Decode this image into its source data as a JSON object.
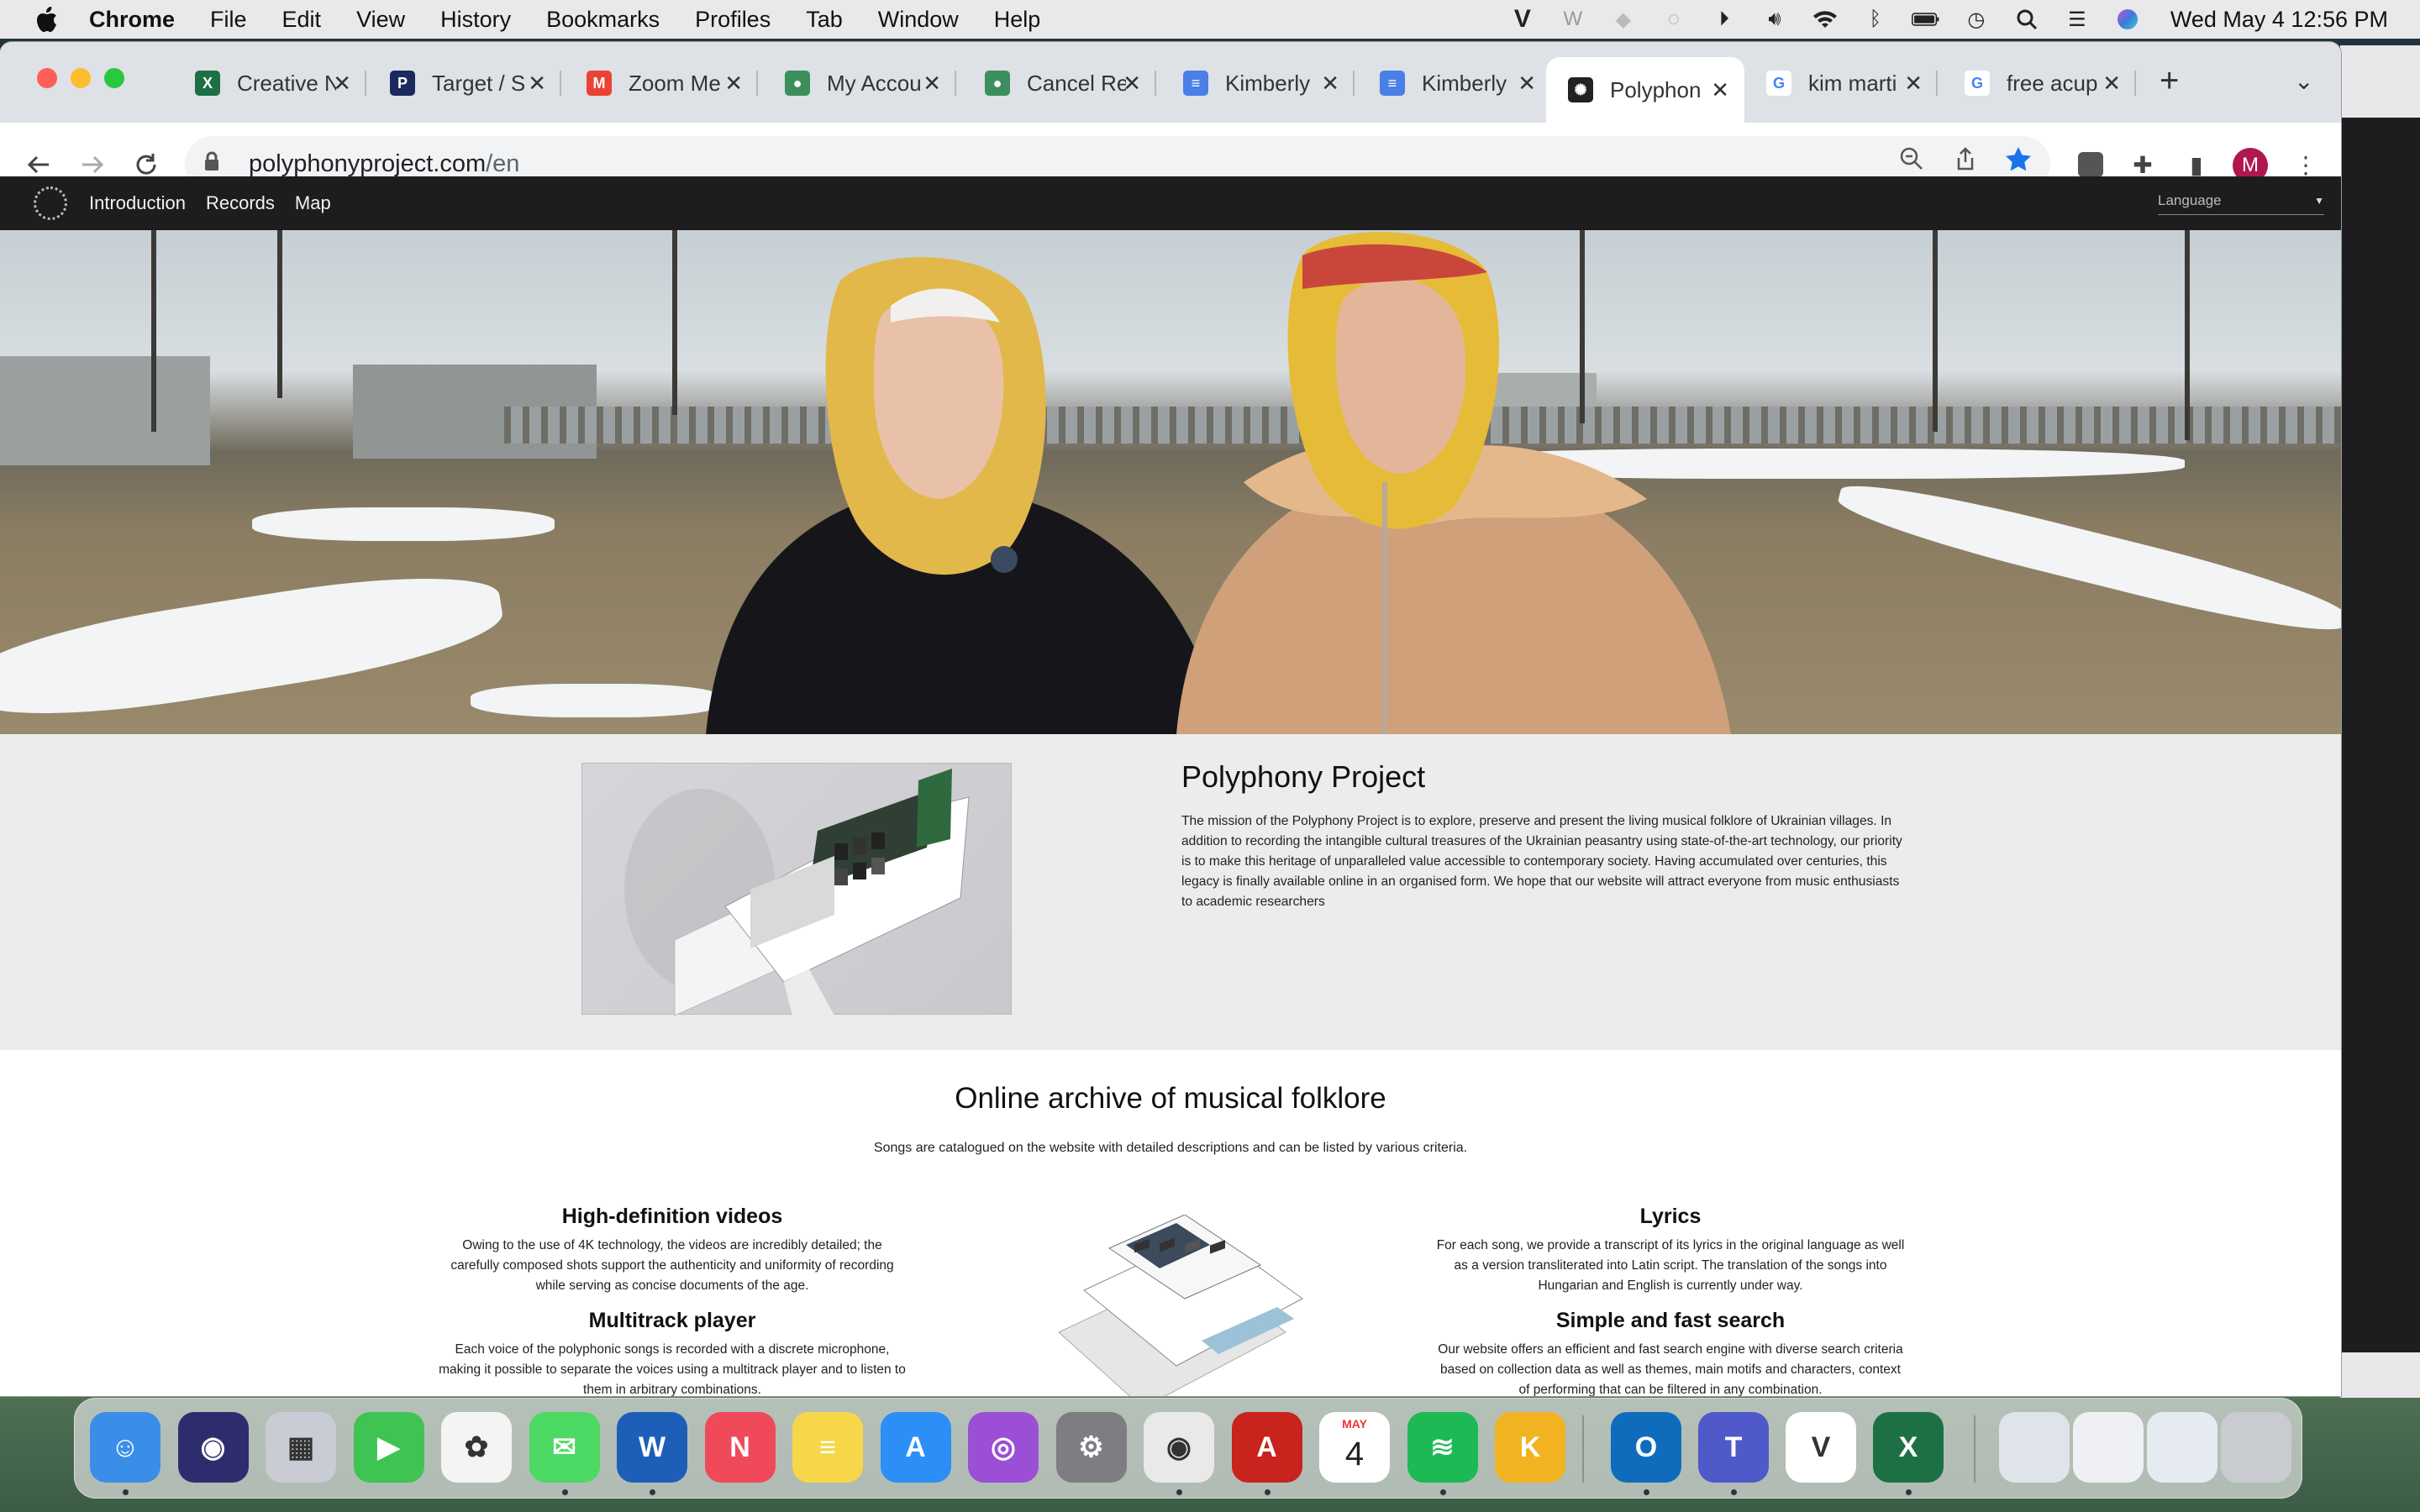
{
  "menubar": {
    "app": "Chrome",
    "items": [
      "File",
      "Edit",
      "View",
      "History",
      "Bookmarks",
      "Profiles",
      "Tab",
      "Window",
      "Help"
    ],
    "clock": "Wed May 4  12:56 PM"
  },
  "tabs": [
    {
      "label": "Creative N",
      "icon": "excel-icon",
      "color": "#1d7044",
      "glyph": "X"
    },
    {
      "label": "Target / S",
      "icon": "paypal-icon",
      "color": "#1b2a5e",
      "glyph": "P"
    },
    {
      "label": "Zoom Me",
      "icon": "gmail-icon",
      "color": "#ea4335",
      "glyph": "M"
    },
    {
      "label": "My Accou",
      "icon": "account-icon",
      "color": "#3b8f5c",
      "glyph": "●"
    },
    {
      "label": "Cancel Re",
      "icon": "account-icon",
      "color": "#3b8f5c",
      "glyph": "●"
    },
    {
      "label": "Kimberly",
      "icon": "docs-icon",
      "color": "#4a7fe8",
      "glyph": "≡"
    },
    {
      "label": "Kimberly",
      "icon": "docs-icon",
      "color": "#4a7fe8",
      "glyph": "≡"
    },
    {
      "label": "Polyphon",
      "icon": "polyphony-icon",
      "color": "#222222",
      "glyph": "✺",
      "active": true
    },
    {
      "label": "kim marti",
      "icon": "google-icon",
      "color": "#ffffff",
      "glyph": "G"
    },
    {
      "label": "free acup",
      "icon": "google-icon",
      "color": "#ffffff",
      "glyph": "G"
    }
  ],
  "address": {
    "domain": "polyphonyproject.com",
    "path": "/en"
  },
  "site": {
    "nav": [
      "Introduction",
      "Records",
      "Map"
    ],
    "language_placeholder": "Language",
    "about_title": "Polyphony Project",
    "about_text": "The mission of the Polyphony Project is to explore, preserve and present the living musical folklore of Ukrainian villages. In addition to recording the intangible cultural treasures of the Ukrainian peasantry using state-of-the-art technology, our priority is to make this heritage of unparalleled value accessible to contemporary society. Having accumulated over centuries, this legacy is finally available online in an organised form. We hope that our website will attract everyone from music enthusiasts to academic researchers",
    "archive_title": "Online archive of musical folklore",
    "archive_sub": "Songs are catalogued on the website with detailed descriptions and can be listed by various criteria.",
    "features": {
      "hd_title": "High-definition videos",
      "hd_text": "Owing to the use of 4K technology, the videos are incredibly detailed; the carefully composed shots support the authenticity and uniformity of recording while serving as concise documents of the age.",
      "mt_title": "Multitrack player",
      "mt_text": "Each voice of the polyphonic songs is recorded with a discrete microphone, making it possible to separate the voices using a multitrack player and to listen to them in arbitrary combinations.",
      "ly_title": "Lyrics",
      "ly_text": "For each song, we provide a transcript of its lyrics in the original language as well as a version transliterated into Latin script. The translation of the songs into Hungarian and English is currently under way.",
      "sf_title": "Simple and fast search",
      "sf_text": "Our website offers an efficient and fast search engine with diverse search criteria based on collection data as well as themes, main motifs and characters, context of performing that can be filtered in any combination."
    }
  },
  "avatar_letter": "M",
  "dock": [
    {
      "name": "finder-icon",
      "color": "#3a8ee8",
      "glyph": "☺"
    },
    {
      "name": "siri-icon",
      "color": "#2d2d6e",
      "glyph": "◉"
    },
    {
      "name": "launchpad-icon",
      "color": "#c9ccd4",
      "glyph": "▦"
    },
    {
      "name": "facetime-icon",
      "color": "#3fc454",
      "glyph": "▶"
    },
    {
      "name": "photos-icon",
      "color": "#f4f4f4",
      "glyph": "✿"
    },
    {
      "name": "messages-icon",
      "color": "#4cd964",
      "glyph": "✉"
    },
    {
      "name": "word-icon",
      "color": "#1d5fb8",
      "glyph": "W"
    },
    {
      "name": "news-icon",
      "color": "#f04a5a",
      "glyph": "N"
    },
    {
      "name": "notes-icon",
      "color": "#f7d74a",
      "glyph": "≡"
    },
    {
      "name": "app-store-icon",
      "color": "#2b8ff6",
      "glyph": "A"
    },
    {
      "name": "podcasts-icon",
      "color": "#9b4fd6",
      "glyph": "◎"
    },
    {
      "name": "system-preferences-icon",
      "color": "#7d7d82",
      "glyph": "⚙"
    },
    {
      "name": "chrome-icon",
      "color": "#e9e9e9",
      "glyph": "◉"
    },
    {
      "name": "acrobat-icon",
      "color": "#c8231c",
      "glyph": "A"
    },
    {
      "name": "calendar-icon",
      "color": "#ffffff",
      "glyph": "4",
      "month": "MAY"
    },
    {
      "name": "spotify-icon",
      "color": "#1db954",
      "glyph": "≋"
    },
    {
      "name": "keynote-icon",
      "color": "#f2b323",
      "glyph": "K"
    },
    {
      "name": "outlook-icon",
      "color": "#0f6cbd",
      "glyph": "O"
    },
    {
      "name": "teams-icon",
      "color": "#5059c9",
      "glyph": "T"
    },
    {
      "name": "vectorworks-icon",
      "color": "#ffffff",
      "glyph": "V"
    },
    {
      "name": "excel-icon",
      "color": "#1d7044",
      "glyph": "X"
    },
    {
      "name": "downloads-stack-icon",
      "color": "#dfe4ea",
      "glyph": ""
    },
    {
      "name": "documents-stack-icon",
      "color": "#eef0f3",
      "glyph": ""
    },
    {
      "name": "recent-stack-icon",
      "color": "#e6ebf2",
      "glyph": ""
    },
    {
      "name": "trash-icon",
      "color": "#c8ccd0",
      "glyph": ""
    }
  ]
}
